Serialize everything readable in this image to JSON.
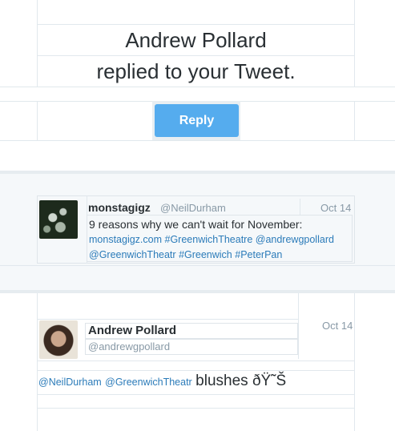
{
  "notification": {
    "actor": "Andrew Pollard",
    "action": "replied to your Tweet."
  },
  "reply_button": {
    "label": "Reply",
    "color": "#55acee"
  },
  "original_tweet": {
    "name": "monstagigz",
    "handle": "@NeilDurham",
    "date": "Oct 14",
    "text": "9 reasons why we can't wait for November:",
    "links_line1": [
      "monstagigz.com",
      "#GreenwichTheatre",
      "@andrewgpollard"
    ],
    "links_line2": [
      "@GreenwichTheatr",
      "#Greenwich",
      "#PeterPan"
    ]
  },
  "reply_tweet": {
    "name": "Andrew Pollard",
    "handle": "@andrewgpollard",
    "date": "Oct 14",
    "mentions": [
      "@NeilDurham",
      "@GreenwichTheatr"
    ],
    "text": "blushes ðŸ˜Š"
  },
  "colors": {
    "link": "#2b7bb9",
    "border": "#e1e8ed",
    "muted": "#8899a6",
    "band": "#f5f8fa"
  }
}
